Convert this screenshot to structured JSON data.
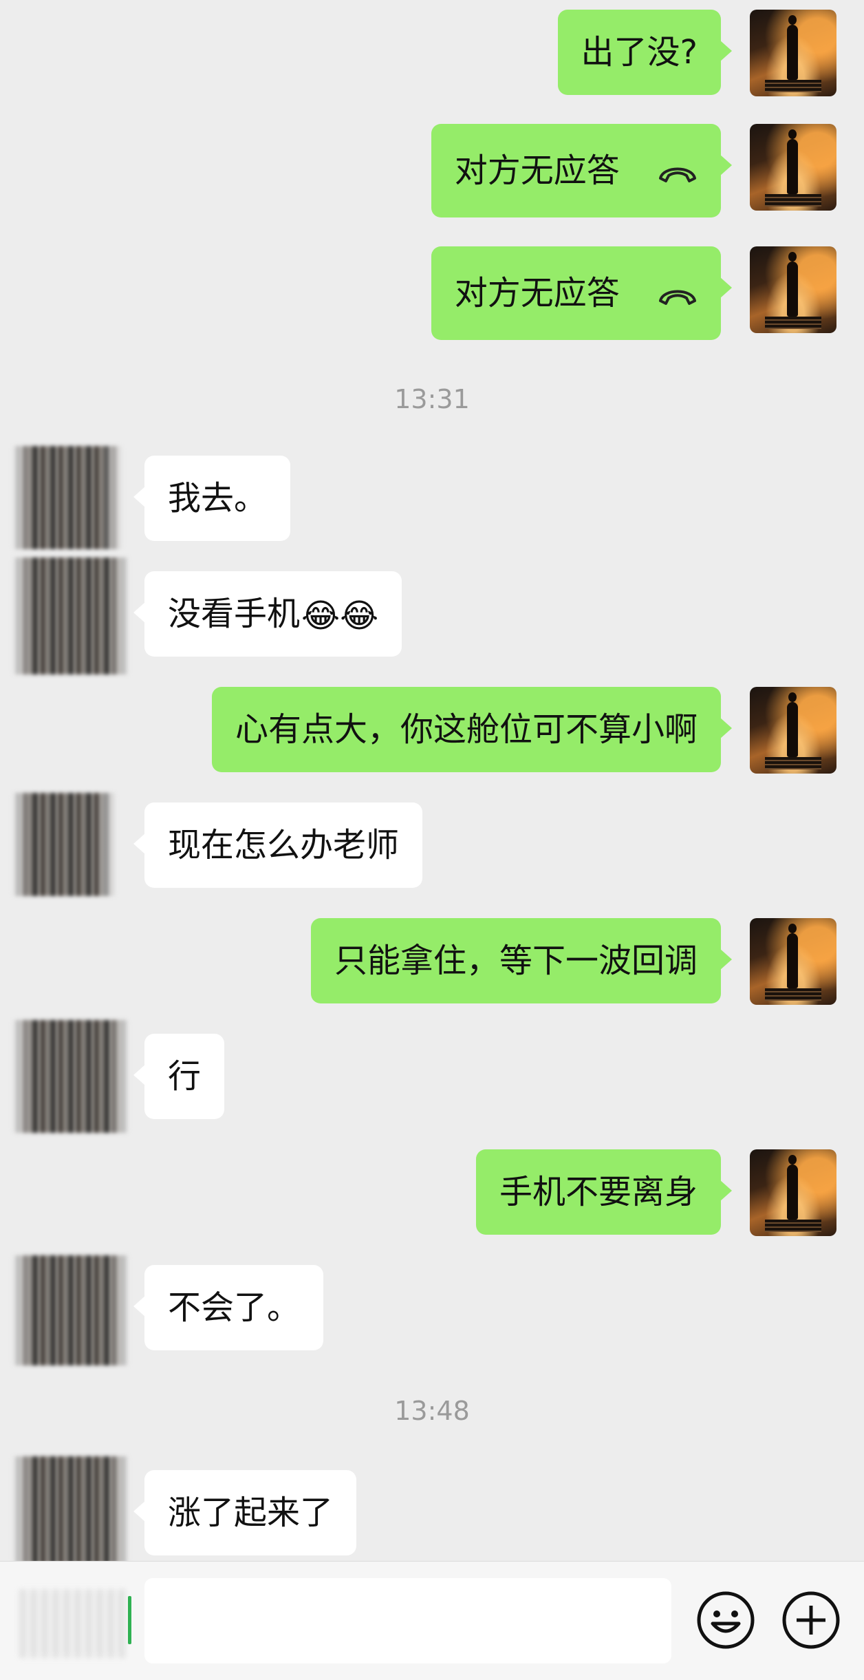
{
  "messages": [
    {
      "side": "me",
      "text": "出了没?"
    },
    {
      "side": "me",
      "text": "对方无应答",
      "icon": "hang-up-phone-icon"
    },
    {
      "side": "me",
      "text": "对方无应答",
      "icon": "hang-up-phone-icon"
    },
    {
      "timestamp": "13:31"
    },
    {
      "side": "them",
      "text": "我去。"
    },
    {
      "side": "them",
      "text": "没看手机",
      "emoji": "😂😂"
    },
    {
      "side": "me",
      "text": "心有点大，你这舱位可不算小啊"
    },
    {
      "side": "them",
      "text": "现在怎么办老师"
    },
    {
      "side": "me",
      "text": "只能拿住，等下一波回调"
    },
    {
      "side": "them",
      "text": "行"
    },
    {
      "side": "me",
      "text": "手机不要离身"
    },
    {
      "side": "them",
      "text": "不会了。"
    },
    {
      "timestamp": "13:48"
    },
    {
      "side": "them",
      "text": "涨了起来了"
    }
  ],
  "input_bar": {
    "value": "",
    "icons": [
      "voice-toggle-icon",
      "emoji-icon",
      "plus-icon"
    ]
  },
  "colors": {
    "background": "#ededed",
    "my_bubble": "#95ec69",
    "their_bubble": "#ffffff",
    "timestamp": "#9a9a9a"
  }
}
